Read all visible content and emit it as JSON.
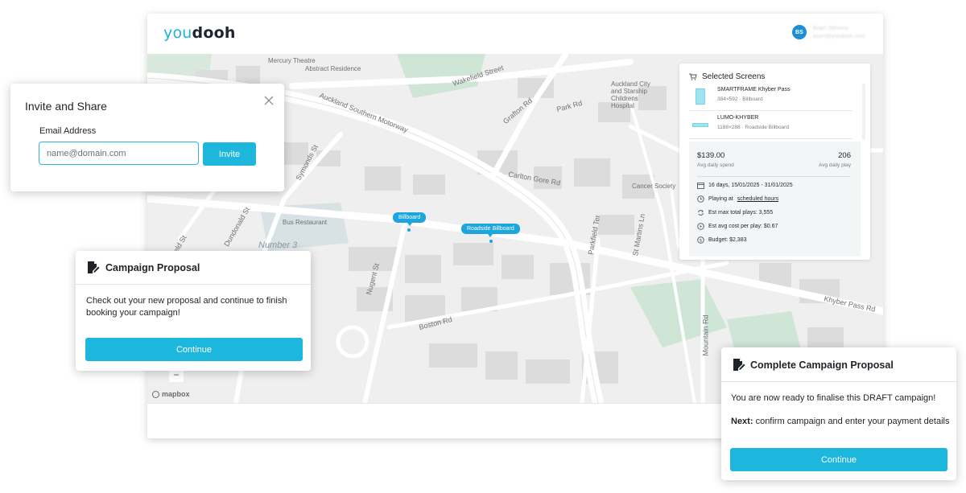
{
  "app": {
    "logo_prefix": "you",
    "logo_suffix": "dooh",
    "user_initials": "BS",
    "user_name": "Bram Stevens",
    "user_email": "bram@youdooh.com"
  },
  "map": {
    "labels": {
      "mercury_theatre": "Mercury Theatre",
      "abstract_residence": "Abstract Residence",
      "wakefield_street": "Wakefield Street",
      "auckland_southern_motorway": "Auckland Southern Motorway",
      "grafton_rd": "Grafton Rd",
      "park_rd": "Park Rd",
      "auckland_city_hospital": "Auckland City and Starship Childrens Hospital",
      "symonds_st": "Symonds St",
      "carlton_gore_rd": "Carlton Gore Rd",
      "cancer_society": "Cancer Society",
      "bus_restaurant": "Bus Restaurant",
      "dundonald_st": "Dundonald St",
      "reservoir": "Number 3 Khyber Reservoir",
      "nugent_st": "Nugent St",
      "boston_rd": "Boston Rd",
      "mountain_rd": "Mountain Rd",
      "khyber_pass_rd": "Khyber Pass Rd",
      "parkfield_ter": "Parkfield Ter",
      "fairfield_st": "Fairfield St",
      "st_martins_ln": "St Martins Ln"
    },
    "pins": {
      "billboard": "Billboard",
      "roadside_billboard": "Roadside Billboard"
    },
    "zoom_out": "−",
    "attribution": "mapbox"
  },
  "selected_screens": {
    "title": "Selected Screens",
    "items": [
      {
        "name": "SMARTFRAME Khyber Pass",
        "meta": "384×592 · Billboard"
      },
      {
        "name": "LUMO-KHYBER",
        "meta": "1188×288 · Roadside Billboard"
      }
    ],
    "avg_daily_spend_value": "$139.00",
    "avg_daily_spend_label": "Avg daily spend",
    "avg_daily_play_value": "206",
    "avg_daily_play_label": "Avg daily play",
    "dates": "16 days, 15/01/2025 - 31/01/2025",
    "playing_at_prefix": "Playing at",
    "playing_at_link": "scheduled hours",
    "est_max_plays": "Est max total plays: 3,555",
    "est_avg_cost": "Est avg cost per play: $0.67",
    "budget": "Budget: $2,383"
  },
  "invite": {
    "title": "Invite and Share",
    "email_label": "Email Address",
    "email_placeholder": "name@domain.com",
    "invite_button": "Invite"
  },
  "proposal": {
    "title": "Campaign Proposal",
    "body": "Check out your new proposal and continue to finish booking your campaign!",
    "continue_button": "Continue"
  },
  "complete": {
    "title": "Complete Campaign Proposal",
    "text1": "You are now ready to finalise this DRAFT campaign!",
    "next_label": "Next:",
    "next_text": " confirm campaign and enter your payment details",
    "continue_button": "Continue"
  },
  "colors": {
    "accent": "#1db6dc",
    "pin": "#1da6dd",
    "map_bg": "#efefef",
    "park": "#cfe6d7"
  }
}
